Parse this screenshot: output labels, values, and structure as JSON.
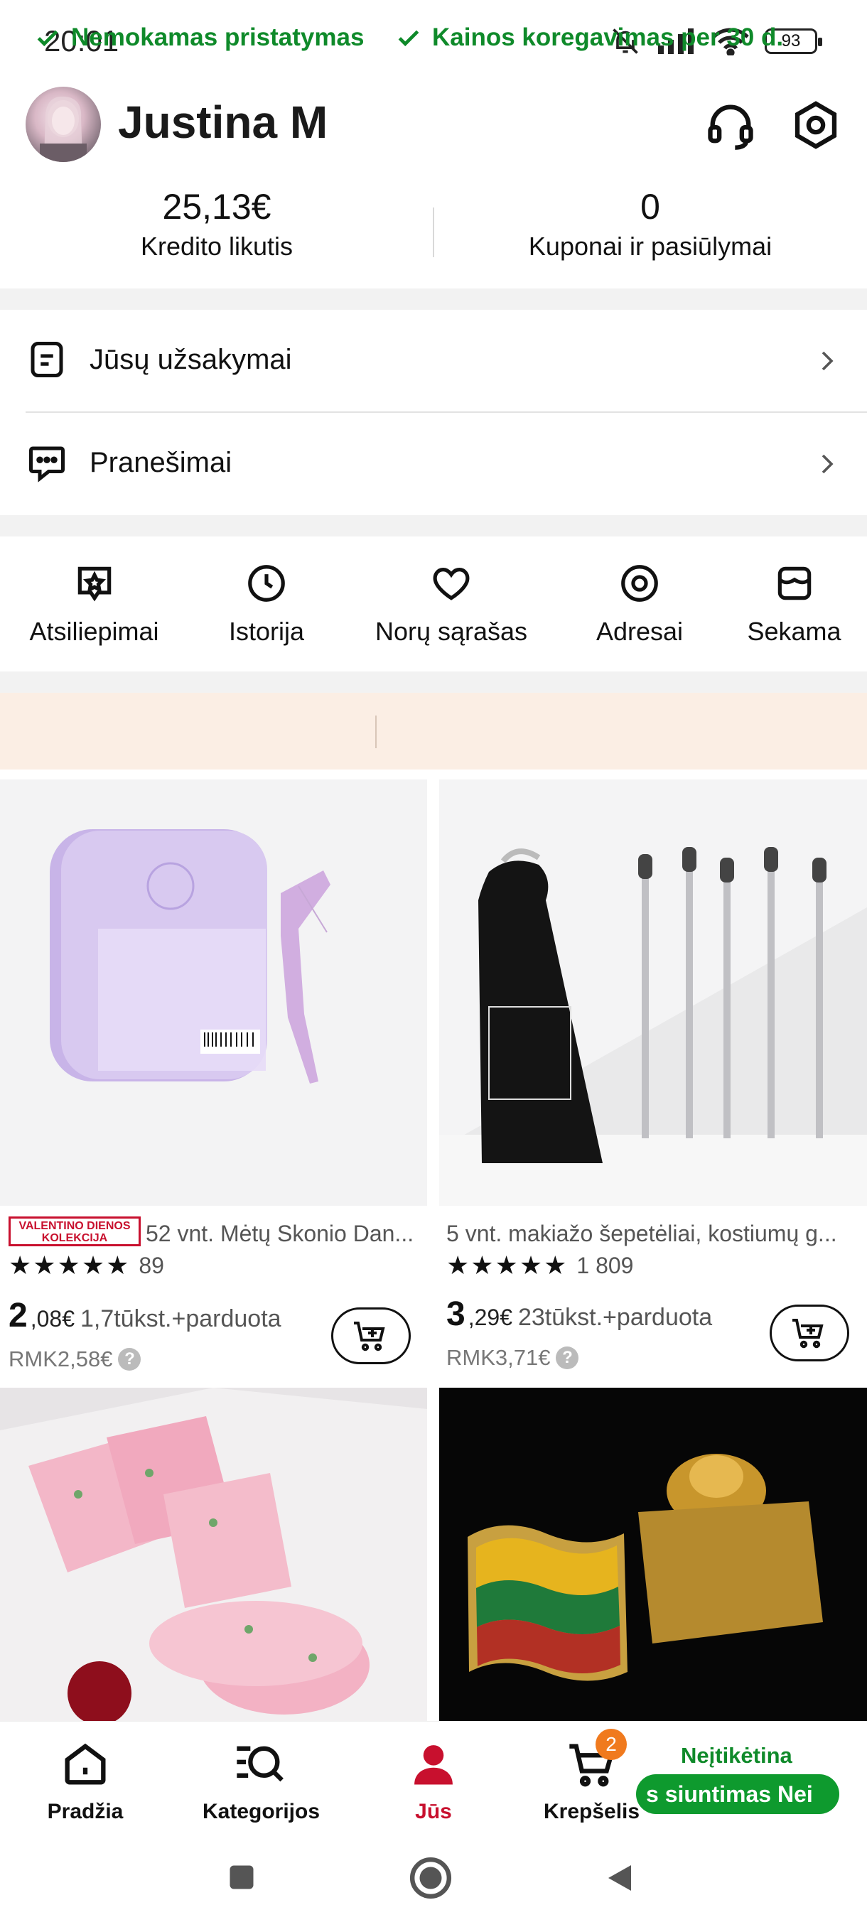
{
  "status_bar": {
    "time": "20:01",
    "battery": "93"
  },
  "profile": {
    "name": "Justina M"
  },
  "stats": {
    "credit_value": "25,13€",
    "credit_label": "Kredito likutis",
    "coupons_value": "0",
    "coupons_label": "Kuponai ir pasiūlymai"
  },
  "menu": {
    "orders": "Jūsų užsakymai",
    "messages": "Pranešimai"
  },
  "quick_actions": [
    {
      "label": "Atsiliepimai",
      "icon": "review-icon"
    },
    {
      "label": "Istorija",
      "icon": "clock-icon"
    },
    {
      "label": "Norų sąrašas",
      "icon": "heart-icon"
    },
    {
      "label": "Adresai",
      "icon": "location-icon"
    },
    {
      "label": "Sekama",
      "icon": "store-icon"
    }
  ],
  "promo": {
    "free_shipping": "Nemokamas pristatymas",
    "price_adjust": "Kainos koregavimas per 30 d."
  },
  "products": [
    {
      "badge_line1": "VALENTINO DIENOS",
      "badge_line2": "KOLEKCIJA",
      "title": "52 vnt. Mėtų Skonio Dan...",
      "rating_count": "89",
      "rating": 5,
      "price_int": "2",
      "price_dec": ",08€",
      "sold": "1,7tūkst.+parduota",
      "rmk": "RMK2,58€"
    },
    {
      "title": "5 vnt. makiažo šepetėliai, kostiumų g...",
      "rating_count": "1 809",
      "rating": 4.5,
      "price_int": "3",
      "price_dec": ",29€",
      "sold": "23tūkst.+parduota",
      "rmk": "RMK3,71€"
    }
  ],
  "bottom_nav": {
    "home": "Pradžia",
    "categories": "Kategorijos",
    "you": "Jūs",
    "cart": "Krepšelis",
    "cart_count": "2",
    "ship_title": "Neįtikėtina",
    "ship_pill": "s siuntimas   Nei"
  },
  "colors": {
    "accent": "#c8102e",
    "green": "#0f8a2a",
    "promo_bg": "#fbeee4",
    "badge_orange": "#f07a1e"
  }
}
